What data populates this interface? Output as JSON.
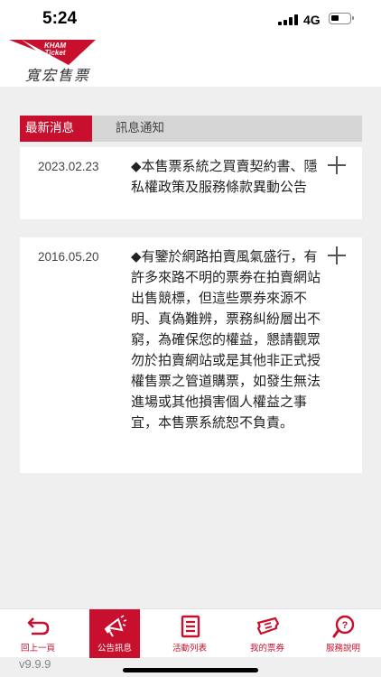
{
  "status_bar": {
    "time": "5:24",
    "network": "4G"
  },
  "header": {
    "logo_text": "KHAM\nTicket",
    "brand": "寬宏售票"
  },
  "tabs": [
    {
      "label": "最新消息",
      "active": true
    },
    {
      "label": "訊息通知",
      "active": false
    }
  ],
  "news": [
    {
      "date": "2023.02.23",
      "text": "◆本售票系統之買賣契約書、隱私權政策及服務條款異動公告"
    },
    {
      "date": "2016.05.20",
      "text": "◆有鑒於網路拍賣風氣盛行，有許多來路不明的票券在拍賣網站出售競標，但這些票券來源不明、真偽難辨，票務糾紛層出不窮，為確保您的權益，懇請觀眾勿於拍賣網站或是其他非正式授權售票之管道購票，如發生無法進場或其他損害個人權益之事宜，本售票系統恕不負責。"
    }
  ],
  "bottom_nav": [
    {
      "label": "回上一頁",
      "icon": "back-arrow-icon"
    },
    {
      "label": "公告訊息",
      "icon": "megaphone-icon",
      "active": true
    },
    {
      "label": "活動列表",
      "icon": "list-icon"
    },
    {
      "label": "我的票券",
      "icon": "ticket-icon"
    },
    {
      "label": "服務說明",
      "icon": "help-icon"
    }
  ],
  "version": "v9.9.9",
  "colors": {
    "accent": "#c8102e",
    "tab_bar": "#d5d5d5",
    "background": "#efefef"
  }
}
